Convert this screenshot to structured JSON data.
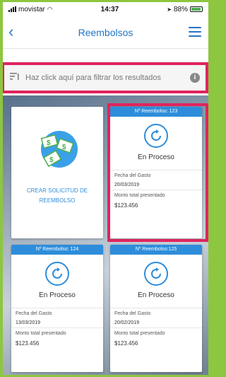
{
  "status_bar": {
    "carrier": "movistar",
    "time": "14:37",
    "battery": "88%"
  },
  "nav": {
    "title": "Reembolsos"
  },
  "filter": {
    "text": "Haz click aquí para filtrar los resultados"
  },
  "create": {
    "label": "CREAR SOLICITUD DE REEMBOLSO"
  },
  "cards": [
    {
      "header": "Nº Reembolso: 123",
      "status": "En Proceso",
      "date_label": "Fecha del Gasto",
      "date_value": "20/03/2019",
      "amount_label": "Monto total presentado",
      "amount_value": "$123.456"
    },
    {
      "header": "Nº Reembolso: 124",
      "status": "En Proceso",
      "date_label": "Fecha del Gasto",
      "date_value": "13/03/2019",
      "amount_label": "Monto total presentado",
      "amount_value": "$123.456"
    },
    {
      "header": "Nº Reembolso:125",
      "status": "En Proceso",
      "date_label": "Fecha del Gasto",
      "date_value": "20/02/2019",
      "amount_label": "Monto total presentado",
      "amount_value": "$123.456"
    }
  ],
  "colors": {
    "primary": "#2e8ddb",
    "highlight": "#e0245e",
    "frame": "#8dc63f"
  }
}
